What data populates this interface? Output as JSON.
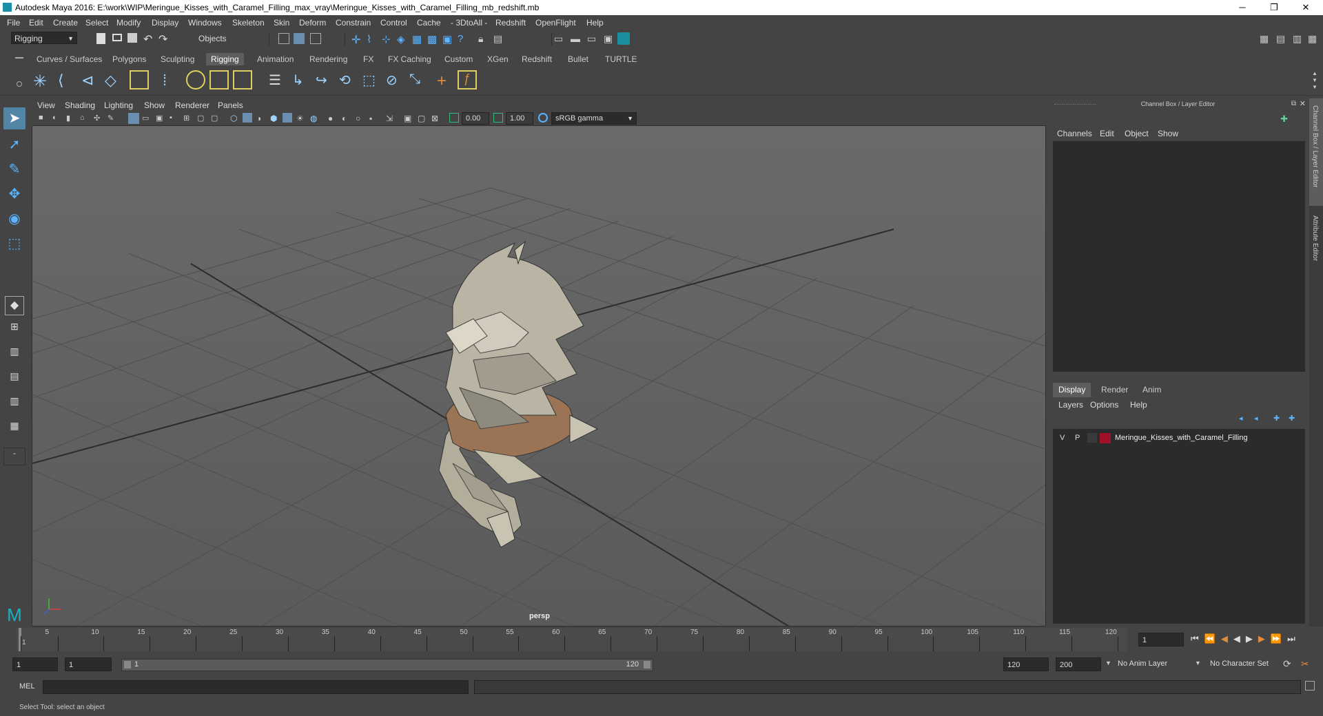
{
  "titlebar": {
    "title": "Autodesk Maya 2016: E:\\work\\WIP\\Meringue_Kisses_with_Caramel_Filling_max_vray\\Meringue_Kisses_with_Caramel_Filling_mb_redshift.mb",
    "minimize": "─",
    "restore": "❐",
    "close": "✕"
  },
  "menubar": [
    "File",
    "Edit",
    "Create",
    "Select",
    "Modify",
    "Display",
    "Windows",
    "Skeleton",
    "Skin",
    "Deform",
    "Constrain",
    "Control",
    "Cache",
    "- 3DtoAll -",
    "Redshift",
    "OpenFlight",
    "Help"
  ],
  "statusline": {
    "mode": "Rigging",
    "selection_mode": "Objects"
  },
  "shelf_tabs": [
    "Curves / Surfaces",
    "Polygons",
    "Sculpting",
    "Rigging",
    "Animation",
    "Rendering",
    "FX",
    "FX Caching",
    "Custom",
    "XGen",
    "Redshift",
    "Bullet",
    "TURTLE"
  ],
  "shelf_active": "Rigging",
  "viewport": {
    "menus": [
      "View",
      "Shading",
      "Lighting",
      "Show",
      "Renderer",
      "Panels"
    ],
    "exposure": "0.00",
    "gamma": "1.00",
    "color_space": "sRGB gamma",
    "camera_label": "persp"
  },
  "channel_box": {
    "title": "Channel Box / Layer Editor",
    "menus": [
      "Channels",
      "Edit",
      "Object",
      "Show"
    ],
    "layer_tabs": [
      "Display",
      "Render",
      "Anim"
    ],
    "layer_active": "Display",
    "layer_menus": [
      "Layers",
      "Options",
      "Help"
    ],
    "layers": [
      {
        "v": "V",
        "p": "P",
        "color": "#a0102a",
        "name": "Meringue_Kisses_with_Caramel_Filling"
      }
    ]
  },
  "side_tabs": [
    "Channel Box / Layer Editor",
    "Attribute Editor"
  ],
  "timeline": {
    "ticks": [
      "1",
      "5",
      "10",
      "15",
      "20",
      "25",
      "30",
      "35",
      "40",
      "45",
      "50",
      "55",
      "60",
      "65",
      "70",
      "75",
      "80",
      "85",
      "90",
      "95",
      "100",
      "105",
      "110",
      "115",
      "120"
    ],
    "current_frame": "1"
  },
  "range": {
    "start": "1",
    "playback_start": "1",
    "slider_start": "1",
    "slider_end": "120",
    "playback_end": "120",
    "end": "200",
    "anim_layer": "No Anim Layer",
    "character_set": "No Character Set"
  },
  "command_line": {
    "label": "MEL"
  },
  "help_line": "Select Tool: select an object"
}
